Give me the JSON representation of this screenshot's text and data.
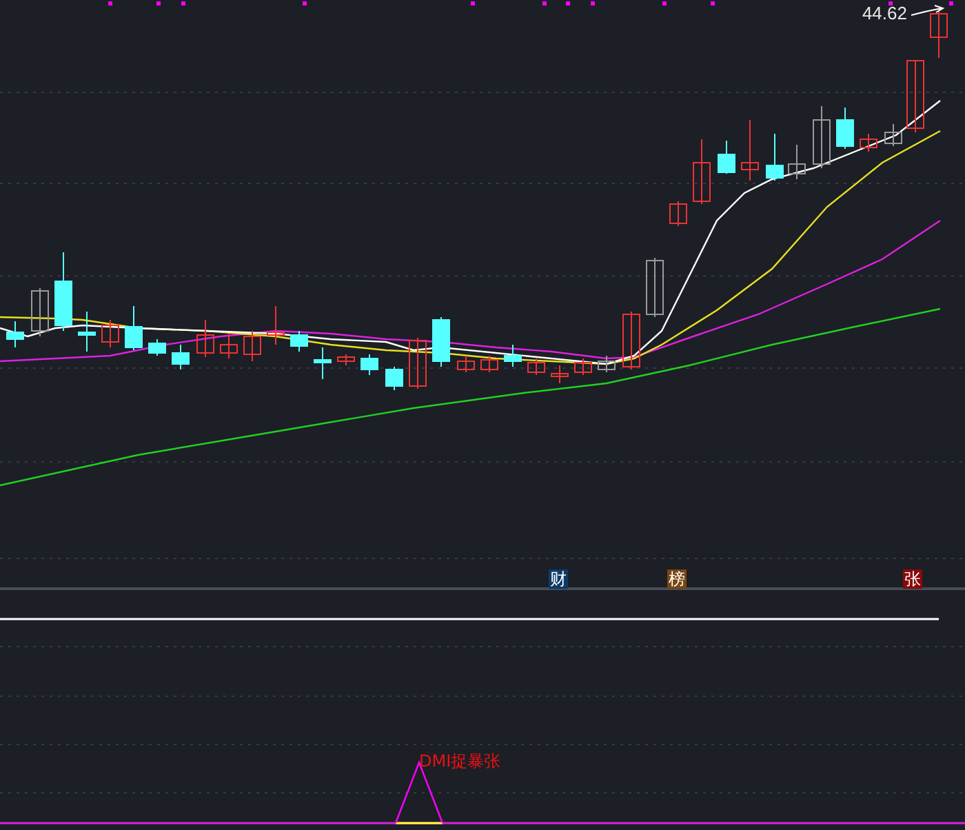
{
  "price_chart": {
    "last_price_label": "44.62"
  },
  "markers": [
    {
      "text": "财",
      "color": "#0e3a68"
    },
    {
      "text": "榜",
      "color": "#7a4510"
    },
    {
      "text": "张",
      "color": "#8a0a0a"
    }
  ],
  "indicator": {
    "signal_label": "DMI捉暴张"
  }
}
